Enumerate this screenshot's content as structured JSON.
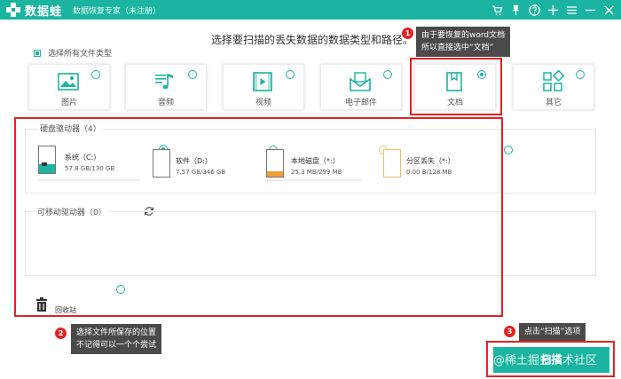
{
  "app": {
    "logo_text": "数据蛙",
    "subtitle": "数据恢复专家（未注册）"
  },
  "titlebar_icons": [
    "cart-icon",
    "pin-icon",
    "help-icon",
    "plus-icon",
    "menu-icon",
    "minimize-icon",
    "close-icon"
  ],
  "prompt": "选择要扫描的丢失数据的数据类型和路径。",
  "select_all": {
    "label": "选择所有文件类型",
    "checked": true
  },
  "file_types": [
    {
      "id": "image",
      "label": "图片",
      "icon": "image-icon",
      "selected": false
    },
    {
      "id": "audio",
      "label": "音频",
      "icon": "music-icon",
      "selected": false
    },
    {
      "id": "video",
      "label": "视频",
      "icon": "video-icon",
      "selected": false
    },
    {
      "id": "email",
      "label": "电子邮件",
      "icon": "email-icon",
      "selected": false
    },
    {
      "id": "document",
      "label": "文档",
      "icon": "document-icon",
      "selected": true
    },
    {
      "id": "other",
      "label": "其它",
      "icon": "apps-icon",
      "selected": false
    }
  ],
  "hard_drives": {
    "title": "硬盘驱动器（4）",
    "items": [
      {
        "name": "系统（C:）",
        "size": "57.8 GB/130 GB",
        "usage": 0.44,
        "color": "#1bb4a0",
        "selected": true
      },
      {
        "name": "软件（D:）",
        "size": "7.57 GB/346 GB",
        "usage": 0.02,
        "color": "#1bb4a0",
        "selected": false
      },
      {
        "name": "本地磁盘（*:）",
        "size": "25.3 MB/299 MB",
        "usage": 0.08,
        "color": "#f0a030",
        "selected": false
      },
      {
        "name": "分区丢失（*:）",
        "size": "0.00 B/128 MB",
        "usage": 0.0,
        "color": "#f0a030",
        "selected": false
      }
    ]
  },
  "removable": {
    "title": "可移动驱动器（0）"
  },
  "recycle_bin": {
    "label": "回收站"
  },
  "callouts": [
    {
      "num": "1",
      "lines": [
        "由于要恢复的word文档",
        "所以直接选中“文档”"
      ]
    },
    {
      "num": "2",
      "lines": [
        "选择文件所保存的位置",
        "不记得可以一个个尝试"
      ]
    },
    {
      "num": "3",
      "lines": [
        "点击“扫描”选项"
      ]
    }
  ],
  "scan_button": {
    "label": "扫描"
  },
  "watermark": "@稀土掘金技术社区",
  "colors": {
    "accent": "#1bb4a0",
    "highlight": "#e02424",
    "warning": "#f0a030"
  }
}
